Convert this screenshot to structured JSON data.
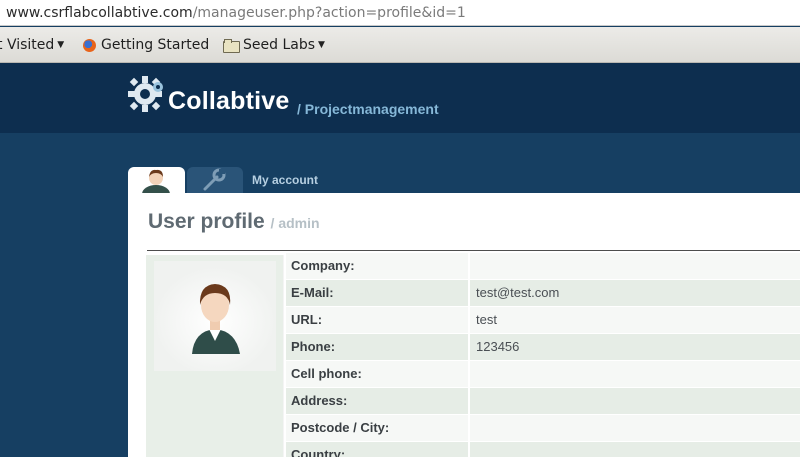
{
  "browser": {
    "url_domain": "www.csrflabcollabtive.com",
    "url_path": "/manageuser.php?action=profile&id=1",
    "bookmarks": [
      {
        "label": "t Visited",
        "icon": "dropdown-arrow"
      },
      {
        "label": "Getting Started",
        "icon": "firefox-icon"
      },
      {
        "label": "Seed Labs",
        "icon": "folder-icon"
      }
    ]
  },
  "header": {
    "brand": "Collabtive",
    "sub": "/ Projectmanagement"
  },
  "tabs": {
    "label": "My account"
  },
  "profile": {
    "title": "User profile",
    "title_sub": "/ admin",
    "fields": [
      {
        "label": "Company:",
        "value": ""
      },
      {
        "label": "E-Mail:",
        "value": "test@test.com"
      },
      {
        "label": "URL:",
        "value": "test"
      },
      {
        "label": "Phone:",
        "value": "123456"
      },
      {
        "label": "Cell phone:",
        "value": ""
      },
      {
        "label": "Address:",
        "value": ""
      },
      {
        "label": "Postcode / City:",
        "value": ""
      },
      {
        "label": "Country:",
        "value": ""
      }
    ]
  },
  "colors": {
    "header_bg": "#0d2e4f",
    "page_bg": "#163f62",
    "accent": "#86b8d8"
  }
}
